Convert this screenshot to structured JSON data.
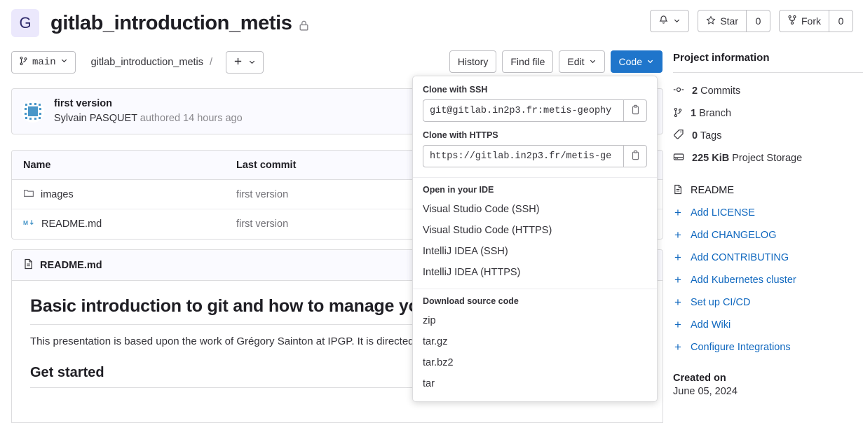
{
  "header": {
    "avatar_letter": "G",
    "project_title": "gitlab_introduction_metis",
    "lock_icon": "lock-icon",
    "notification_icon": "bell-icon",
    "star_label": "Star",
    "star_count": "0",
    "fork_label": "Fork",
    "fork_count": "0"
  },
  "toolbar": {
    "branch_name": "main",
    "breadcrumb_root": "gitlab_introduction_metis",
    "breadcrumb_sep": "/",
    "add_label": "+",
    "history_label": "History",
    "find_file_label": "Find file",
    "edit_label": "Edit",
    "code_label": "Code"
  },
  "commit": {
    "title": "first version",
    "author": "Sylvain PASQUET",
    "meta": "authored 14 hours ago"
  },
  "files": {
    "columns": [
      "Name",
      "Last commit"
    ],
    "rows": [
      {
        "icon": "folder-icon",
        "name": "images",
        "last_commit": "first version"
      },
      {
        "icon": "markdown-icon",
        "name": "README.md",
        "last_commit": "first version"
      }
    ]
  },
  "readme": {
    "header": "README.md",
    "heading": "Basic introduction to git and how to manage your",
    "paragraph": "This presentation is based upon the work of Grégory Sainton at IPGP. It is directed team.",
    "subheading": "Get started"
  },
  "sidebar": {
    "title": "Project information",
    "stats": [
      {
        "icon": "commit-icon",
        "value": "2",
        "label": "Commits"
      },
      {
        "icon": "branch-icon",
        "value": "1",
        "label": "Branch"
      },
      {
        "icon": "tag-icon",
        "value": "0",
        "label": "Tags"
      },
      {
        "icon": "storage-icon",
        "value": "225 KiB",
        "label": "Project Storage"
      }
    ],
    "links": [
      {
        "icon": "document-icon",
        "label": "README"
      },
      {
        "icon": "plus-icon",
        "label": "Add LICENSE"
      },
      {
        "icon": "plus-icon",
        "label": "Add CHANGELOG"
      },
      {
        "icon": "plus-icon",
        "label": "Add CONTRIBUTING"
      },
      {
        "icon": "plus-icon",
        "label": "Add Kubernetes cluster"
      },
      {
        "icon": "plus-icon",
        "label": "Set up CI/CD"
      },
      {
        "icon": "plus-icon",
        "label": "Add Wiki"
      },
      {
        "icon": "plus-icon",
        "label": "Configure Integrations"
      }
    ],
    "created_label": "Created on",
    "created_date": "June 05, 2024"
  },
  "code_dropdown": {
    "ssh_label": "Clone with SSH",
    "ssh_value": "git@gitlab.in2p3.fr:metis-geophy",
    "https_label": "Clone with HTTPS",
    "https_value": "https://gitlab.in2p3.fr/metis-ge",
    "copy_icon": "copy-icon",
    "ide_label": "Open in your IDE",
    "ide_items": [
      "Visual Studio Code (SSH)",
      "Visual Studio Code (HTTPS)",
      "IntelliJ IDEA (SSH)",
      "IntelliJ IDEA (HTTPS)"
    ],
    "download_label": "Download source code",
    "download_items": [
      "zip",
      "tar.gz",
      "tar.bz2",
      "tar"
    ]
  },
  "colors": {
    "primary": "#1f75cb",
    "link": "#1068bf",
    "border": "#dcdcde",
    "avatar_bg": "#ebe8fc"
  }
}
